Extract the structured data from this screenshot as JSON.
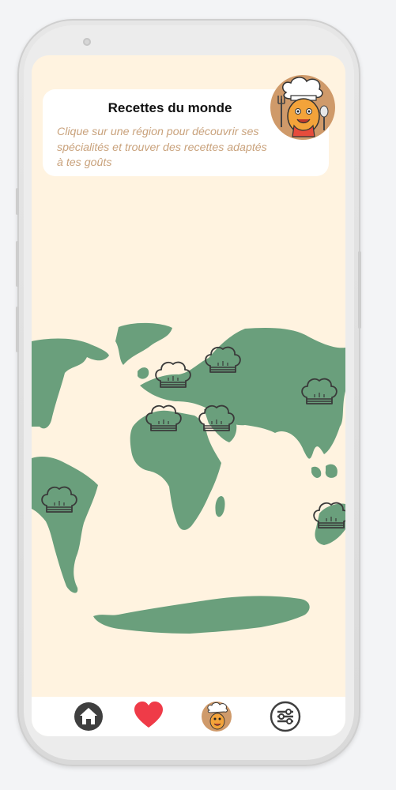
{
  "header": {
    "title": "Recettes du monde",
    "subtitle": "Clique sur une région pour découvrir ses spécialités et trouver des recettes adaptés à tes goûts"
  },
  "colors": {
    "screen_bg": "#fff3e0",
    "land": "#6a9f7c",
    "subtitle": "#c9a27c",
    "heart": "#ef3b48",
    "icon_dark": "#3f3f3f"
  },
  "regions": [
    {
      "name": "north-america",
      "icon": "chef-hat-icon"
    },
    {
      "name": "europe-west",
      "icon": "chef-hat-icon"
    },
    {
      "name": "russia",
      "icon": "chef-hat-icon"
    },
    {
      "name": "east-asia",
      "icon": "chef-hat-icon"
    },
    {
      "name": "africa",
      "icon": "chef-hat-icon"
    },
    {
      "name": "middle-east",
      "icon": "chef-hat-icon"
    },
    {
      "name": "south-america",
      "icon": "chef-hat-icon"
    },
    {
      "name": "oceania",
      "icon": "chef-hat-icon"
    }
  ],
  "nav": [
    {
      "name": "home",
      "icon": "home-icon"
    },
    {
      "name": "favorites",
      "icon": "heart-icon"
    },
    {
      "name": "chef",
      "icon": "chef-mascot-icon"
    },
    {
      "name": "filters",
      "icon": "sliders-icon"
    }
  ]
}
